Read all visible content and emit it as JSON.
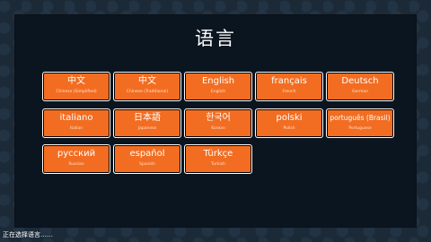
{
  "screen": {
    "title": "语言",
    "status": "正在选择语言……",
    "accent_color": "#f26d21"
  },
  "languages": [
    {
      "name": "中文",
      "sub": "Chinese (Simplified)"
    },
    {
      "name": "中文",
      "sub": "Chinese (Traditional)"
    },
    {
      "name": "English",
      "sub": "English"
    },
    {
      "name": "français",
      "sub": "French"
    },
    {
      "name": "Deutsch",
      "sub": "German"
    },
    {
      "name": "italiano",
      "sub": "Italian"
    },
    {
      "name": "日本語",
      "sub": "Japanese"
    },
    {
      "name": "한국어",
      "sub": "Korean"
    },
    {
      "name": "polski",
      "sub": "Polish"
    },
    {
      "name": "português (Brasil)",
      "sub": "Portuguese"
    },
    {
      "name": "русский",
      "sub": "Russian"
    },
    {
      "name": "español",
      "sub": "Spanish"
    },
    {
      "name": "Türkçe",
      "sub": "Turkish"
    }
  ]
}
